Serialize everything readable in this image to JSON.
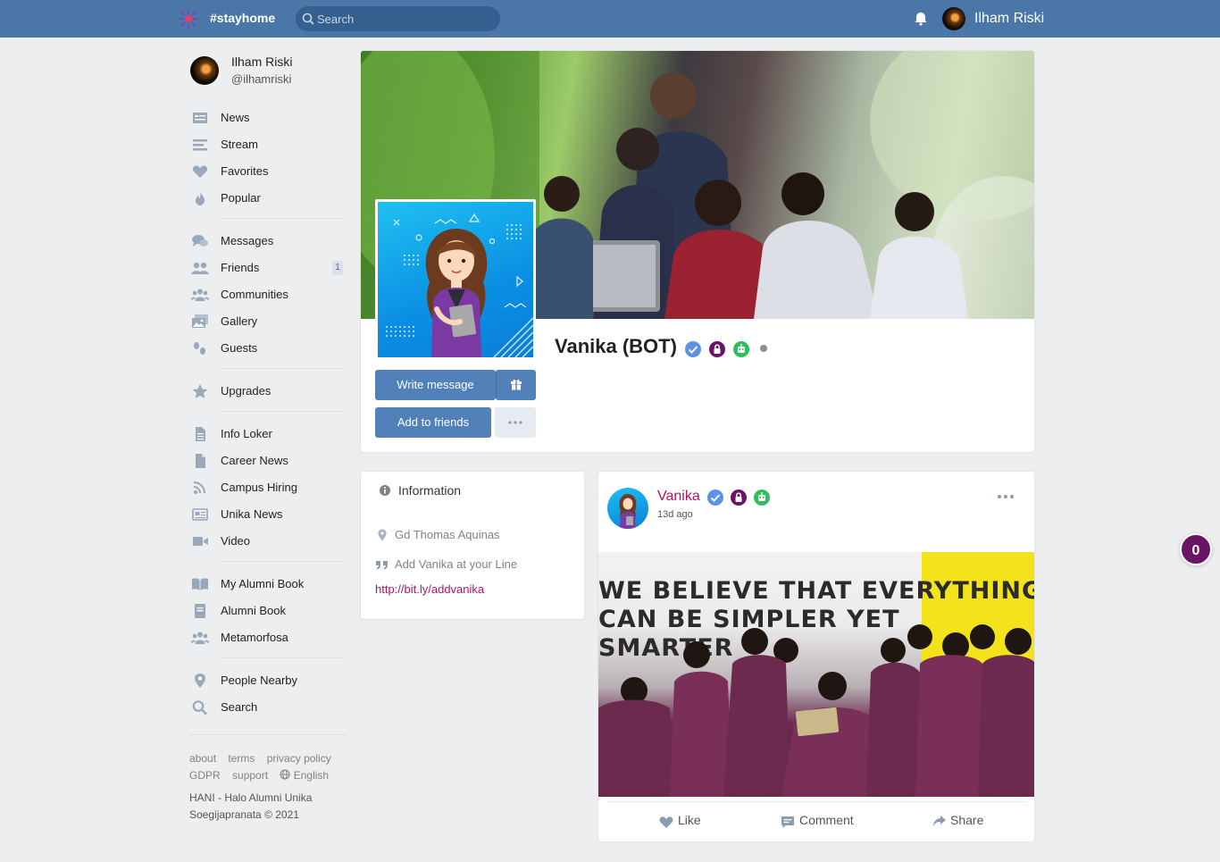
{
  "topbar": {
    "brand": "#stayhome",
    "search_placeholder": "Search",
    "user_name": "Ilham Riski"
  },
  "sidebar": {
    "profile": {
      "name": "Ilham Riski",
      "handle": "@ilhamriski"
    },
    "items": [
      {
        "label": "News",
        "icon": "news-icon"
      },
      {
        "label": "Stream",
        "icon": "stream-icon"
      },
      {
        "label": "Favorites",
        "icon": "heart-icon"
      },
      {
        "label": "Popular",
        "icon": "fire-icon"
      },
      {
        "label": "Messages",
        "icon": "messages-icon"
      },
      {
        "label": "Friends",
        "icon": "friends-icon",
        "badge": "1"
      },
      {
        "label": "Communities",
        "icon": "communities-icon"
      },
      {
        "label": "Gallery",
        "icon": "gallery-icon"
      },
      {
        "label": "Guests",
        "icon": "guests-icon"
      },
      {
        "label": "Upgrades",
        "icon": "star-icon"
      },
      {
        "label": "Info Loker",
        "icon": "document-icon"
      },
      {
        "label": "Career News",
        "icon": "document-icon"
      },
      {
        "label": "Campus Hiring",
        "icon": "rss-icon"
      },
      {
        "label": "Unika News",
        "icon": "newspaper-icon"
      },
      {
        "label": "Video",
        "icon": "video-icon"
      },
      {
        "label": "My Alumni Book",
        "icon": "book-open-icon"
      },
      {
        "label": "Alumni Book",
        "icon": "book-icon"
      },
      {
        "label": "Metamorfosa",
        "icon": "users-icon"
      },
      {
        "label": "People Nearby",
        "icon": "map-pin-icon"
      },
      {
        "label": "Search",
        "icon": "search-icon"
      }
    ],
    "footer": {
      "links": [
        "about",
        "terms",
        "privacy policy",
        "GDPR",
        "support",
        "English"
      ],
      "copyright": "HANI - Halo Alumni Unika Soegijapranata © 2021"
    }
  },
  "profile": {
    "name": "Vanika (BOT)",
    "write_message": "Write message",
    "add_to_friends": "Add to friends"
  },
  "information": {
    "title": "Information",
    "location": "Gd Thomas Aquinas",
    "line_text": "Add Vanika at your Line",
    "link": "http://bit.ly/addvanika"
  },
  "post": {
    "author": "Vanika",
    "time": "13d ago",
    "image_text_line1": "WE BELIEVE THAT EVERYTHING",
    "image_text_line2": "CAN BE SIMPLER YET",
    "image_text_line3": "SMARTER",
    "like": "Like",
    "comment": "Comment",
    "share": "Share"
  },
  "floating_counter": "0",
  "colors": {
    "topbar": "#4a76a8",
    "primary_button": "#5181b8",
    "author_link": "#b0155b",
    "counter": "#6a1466"
  }
}
